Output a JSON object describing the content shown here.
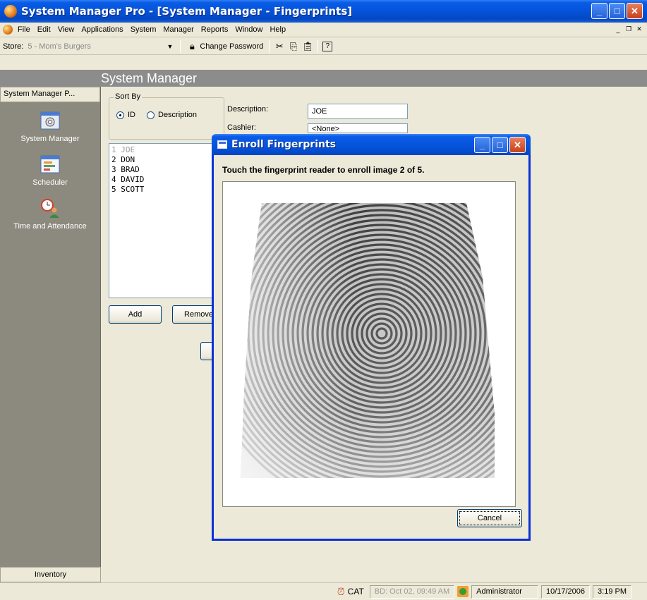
{
  "window": {
    "title": "System Manager Pro - [System Manager - Fingerprints]"
  },
  "menubar": {
    "items": [
      "File",
      "Edit",
      "View",
      "Applications",
      "System",
      "Manager",
      "Reports",
      "Window",
      "Help"
    ]
  },
  "toolbar": {
    "store_label": "Store:",
    "store_value": "5 - Mom's Burgers",
    "change_password": "Change Password"
  },
  "header": {
    "title": "System Manager"
  },
  "sidebar": {
    "section_title": "System Manager P...",
    "items": [
      {
        "label": "System Manager",
        "icon": "gear-window-icon"
      },
      {
        "label": "Scheduler",
        "icon": "scheduler-icon"
      },
      {
        "label": "Time and Attendance",
        "icon": "clock-person-icon"
      }
    ],
    "footer": "Inventory"
  },
  "main": {
    "sort_by": {
      "legend": "Sort By",
      "option_id": "ID",
      "option_description": "Description",
      "selected": "ID"
    },
    "description_label": "Description:",
    "description_value": "JOE",
    "cashier_label": "Cashier:",
    "cashier_value": "<None>",
    "employees": [
      "1 JOE",
      "2 DON",
      "3 BRAD",
      "4 DAVID",
      "5 SCOTT"
    ],
    "add_label": "Add",
    "remove_label": "Remove"
  },
  "dialog": {
    "title": "Enroll Fingerprints",
    "prompt": "Touch the fingerprint reader to enroll image 2 of 5.",
    "cancel_label": "Cancel"
  },
  "statusbar": {
    "location": "CAT",
    "business_date": "BD: Oct 02, 09:49 AM",
    "user": "Administrator",
    "date": "10/17/2006",
    "time": "3:19 PM"
  }
}
